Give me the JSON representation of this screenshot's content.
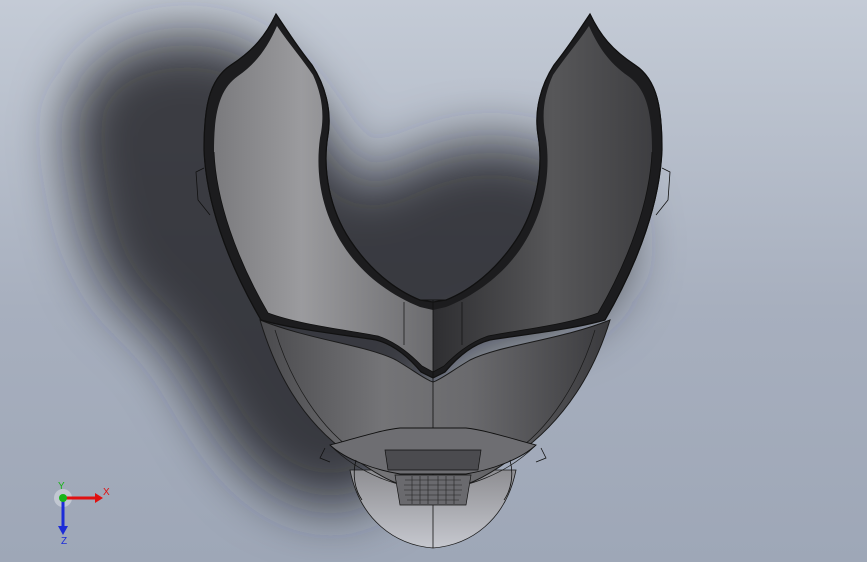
{
  "viewport": {
    "background_top": "#c4cbd6",
    "background_bottom": "#9ea7b7",
    "model_fill_light": "#9a9a9c",
    "model_fill_dark": "#3d3d40",
    "edge_color": "#1a1a1a"
  },
  "triad": {
    "x_label": "X",
    "y_label": "Y",
    "z_label": "Z",
    "x_color": "#e01010",
    "y_color": "#18b418",
    "z_color": "#1c2cd8"
  }
}
